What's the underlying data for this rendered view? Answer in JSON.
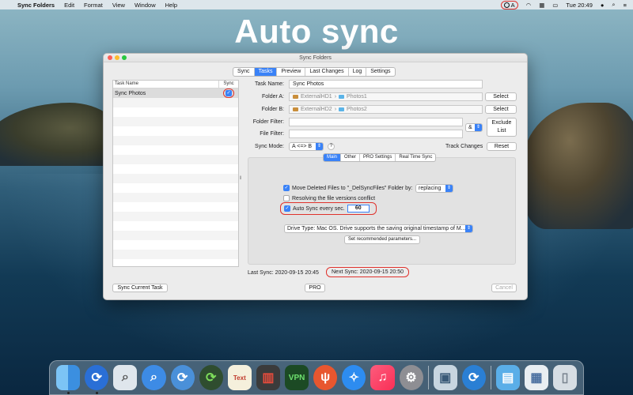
{
  "menubar": {
    "app": "Sync Folders",
    "items": [
      "Edit",
      "Format",
      "View",
      "Window",
      "Help"
    ],
    "status_letter": "A",
    "clock": "Tue 20:49"
  },
  "headline": "Auto sync",
  "window": {
    "title": "Sync Folders",
    "tabs": [
      "Sync",
      "Tasks",
      "Preview",
      "Last Changes",
      "Log",
      "Settings"
    ],
    "active_tab": "Tasks",
    "tasklist": {
      "col_name": "Task Name",
      "col_sync": "Sync",
      "rows": [
        {
          "name": "Sync Photos",
          "sync": true
        }
      ]
    },
    "form": {
      "task_name_label": "Task Name:",
      "task_name_value": "Sync Photos",
      "folder_a_label": "Folder A:",
      "folder_a_drive": "ExternalHD1",
      "folder_a_folder": "Photos1",
      "folder_b_label": "Folder B:",
      "folder_b_drive": "ExternalHD2",
      "folder_b_folder": "Photos2",
      "select_label": "Select",
      "folder_filter_label": "Folder Filter:",
      "file_filter_label": "File Filter:",
      "filter_op": "&",
      "exclude_list_label": "Exclude List",
      "sync_mode_label": "Sync Mode:",
      "sync_mode_value": "A <=> B",
      "help": "?",
      "track_changes_label": "Track Changes",
      "reset_label": "Reset"
    },
    "subtabs": [
      "Main",
      "Other",
      "PRO Settings",
      "Real Time Sync"
    ],
    "active_subtab": "Main",
    "options": {
      "move_deleted_label": "Move Deleted Files to \"_DelSyncFiles\" Folder by:",
      "move_deleted_checked": true,
      "move_deleted_mode": "replacing",
      "resolving_label": "Resolving the file versions conflict",
      "resolving_checked": false,
      "auto_sync_label": "Auto Sync every sec.",
      "auto_sync_checked": true,
      "auto_sync_value": "60",
      "drive_type": "Drive Type: Mac OS. Drive supports the saving original timestamp of M...",
      "set_params_label": "Set recommended parameters..."
    },
    "last_sync": "Last Sync: 2020-09-15 20:45",
    "next_sync": "Next Sync: 2020-09-15 20:50",
    "buttons": {
      "sync_current": "Sync Current Task",
      "pro": "PRO",
      "cancel": "Cancel"
    }
  },
  "dock": {
    "icons": [
      "finder-icon",
      "sync-folders-icon",
      "preview-icon",
      "magnifier-icon",
      "sync-icon",
      "sync-green-icon",
      "textedit-icon",
      "trash-red-icon",
      "vpn-icon",
      "dining-icon",
      "safari-icon",
      "music-icon",
      "settings-icon",
      "photo-icon",
      "sync-blue-icon",
      "folder-icon",
      "window-icon",
      "trash-icon"
    ],
    "vpn_text": "VPN",
    "text_icon_label": "Text"
  }
}
